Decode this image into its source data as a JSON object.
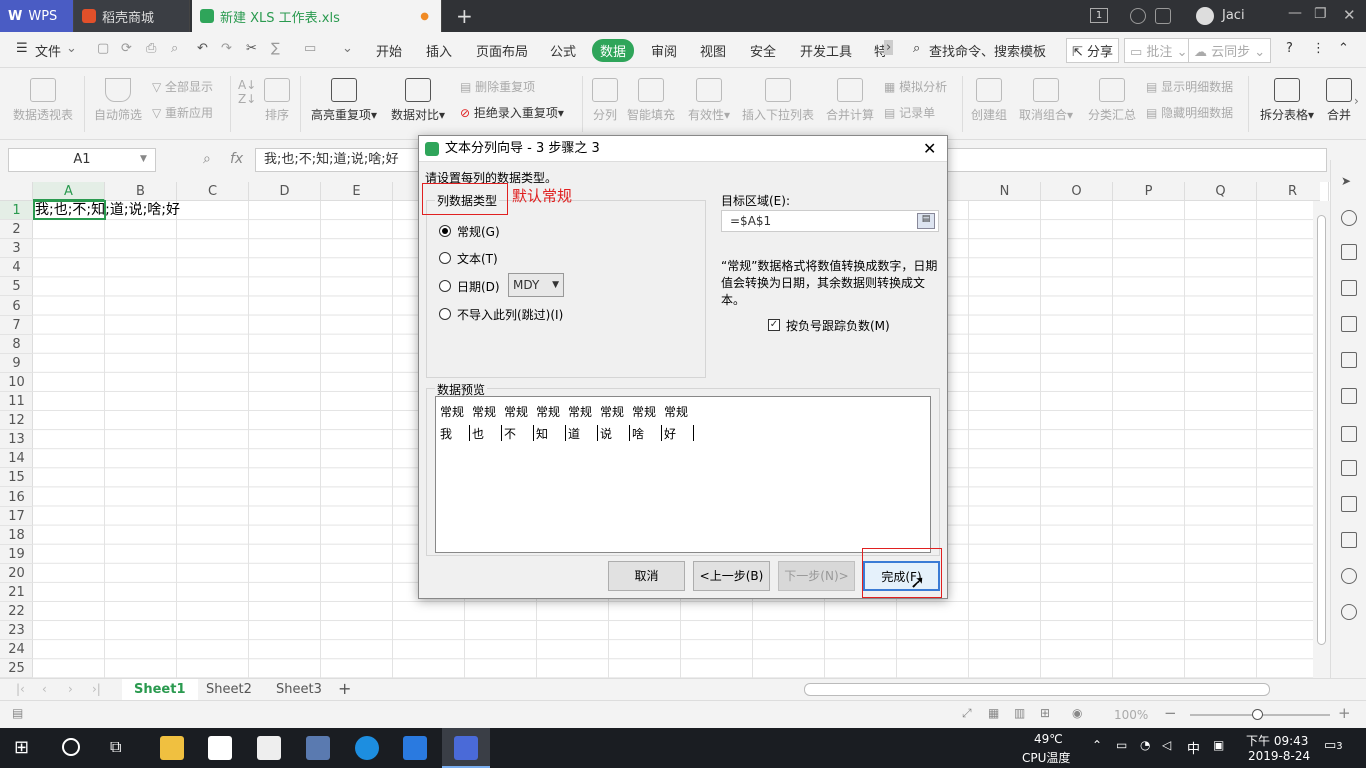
{
  "titlebar": {
    "tabs": [
      {
        "label": "WPS"
      },
      {
        "label": "稻壳商城"
      },
      {
        "label": "新建 XLS 工作表.xls"
      }
    ],
    "new_tab": "+",
    "badge": "1",
    "user": "Jaci"
  },
  "menubar": {
    "file": "文件",
    "items": [
      "开始",
      "插入",
      "页面布局",
      "公式",
      "数据",
      "审阅",
      "视图",
      "安全",
      "开发工具",
      "特"
    ],
    "search": "查找命令、搜索模板",
    "share": "分享",
    "comment": "批注",
    "cloud": "云同步"
  },
  "ribbon": {
    "pivot": "数据透视表",
    "autofilter": "自动筛选",
    "showall": "全部显示",
    "reapply": "重新应用",
    "sort": "排序",
    "highlight_dup": "高亮重复项",
    "compare": "数据对比",
    "delete_dup": "删除重复项",
    "reject_dup": "拒绝录入重复项",
    "split": "分列",
    "smart_fill": "智能填充",
    "validity": "有效性",
    "dropdown": "插入下拉列表",
    "consolidate": "合并计算",
    "simulate": "模拟分析",
    "record": "记录单",
    "group": "创建组",
    "ungroup": "取消组合",
    "subtotal": "分类汇总",
    "show_detail": "显示明细数据",
    "hide_detail": "隐藏明细数据",
    "split_table": "拆分表格",
    "merge": "合并"
  },
  "formulabar": {
    "namebox": "A1",
    "fx": "fx",
    "content": "我;也;不;知;道;说;啥;好"
  },
  "grid": {
    "columns": [
      "A",
      "B",
      "C",
      "D",
      "E",
      "N",
      "O",
      "P",
      "Q",
      "R"
    ],
    "rows": [
      "1",
      "2",
      "3",
      "4",
      "5",
      "6",
      "7",
      "8",
      "9",
      "10",
      "11",
      "12",
      "13",
      "14",
      "15",
      "16",
      "17",
      "18",
      "19",
      "20",
      "21",
      "22",
      "23",
      "24",
      "25"
    ],
    "a1": "我;也;不;知;道;说;啥;好"
  },
  "sheets": [
    "Sheet1",
    "Sheet2",
    "Sheet3"
  ],
  "status": {
    "zoom": "100%"
  },
  "taskbar": {
    "temp": "49℃",
    "temp_label": "CPU温度",
    "ime": "中",
    "time": "下午 09:43",
    "date": "2019-8-24",
    "notif": "3"
  },
  "dialog": {
    "title": "文本分列向导 - 3 步骤之 3",
    "instruction": "请设置每列的数据类型。",
    "group_label": "列数据类型",
    "annotation": "默认常规",
    "options": [
      {
        "label": "常规(G)",
        "selected": true
      },
      {
        "label": "文本(T)",
        "selected": false
      },
      {
        "label": "日期(D)",
        "selected": false
      },
      {
        "label": "不导入此列(跳过)(I)",
        "selected": false
      }
    ],
    "date_format": "MDY",
    "target_label": "目标区域(E):",
    "target_value": "=$A$1",
    "description": "“常规”数据格式将数值转换成数字，日期值会转换为日期，其余数据则转换成文本。",
    "checkbox_label": "按负号跟踪负数(M)",
    "checkbox_checked": true,
    "preview_label": "数据预览",
    "preview_headers": [
      "常规",
      "常规",
      "常规",
      "常规",
      "常规",
      "常规",
      "常规",
      "常规"
    ],
    "preview_values": [
      "我",
      "也",
      "不",
      "知",
      "道",
      "说",
      "啥",
      "好"
    ],
    "buttons": {
      "cancel": "取消",
      "back": "<上一步(B)",
      "next": "下一步(N)>",
      "finish": "完成(F)"
    }
  },
  "colors": {
    "accent": "#2a9a4f",
    "annotation": "#e02020"
  }
}
